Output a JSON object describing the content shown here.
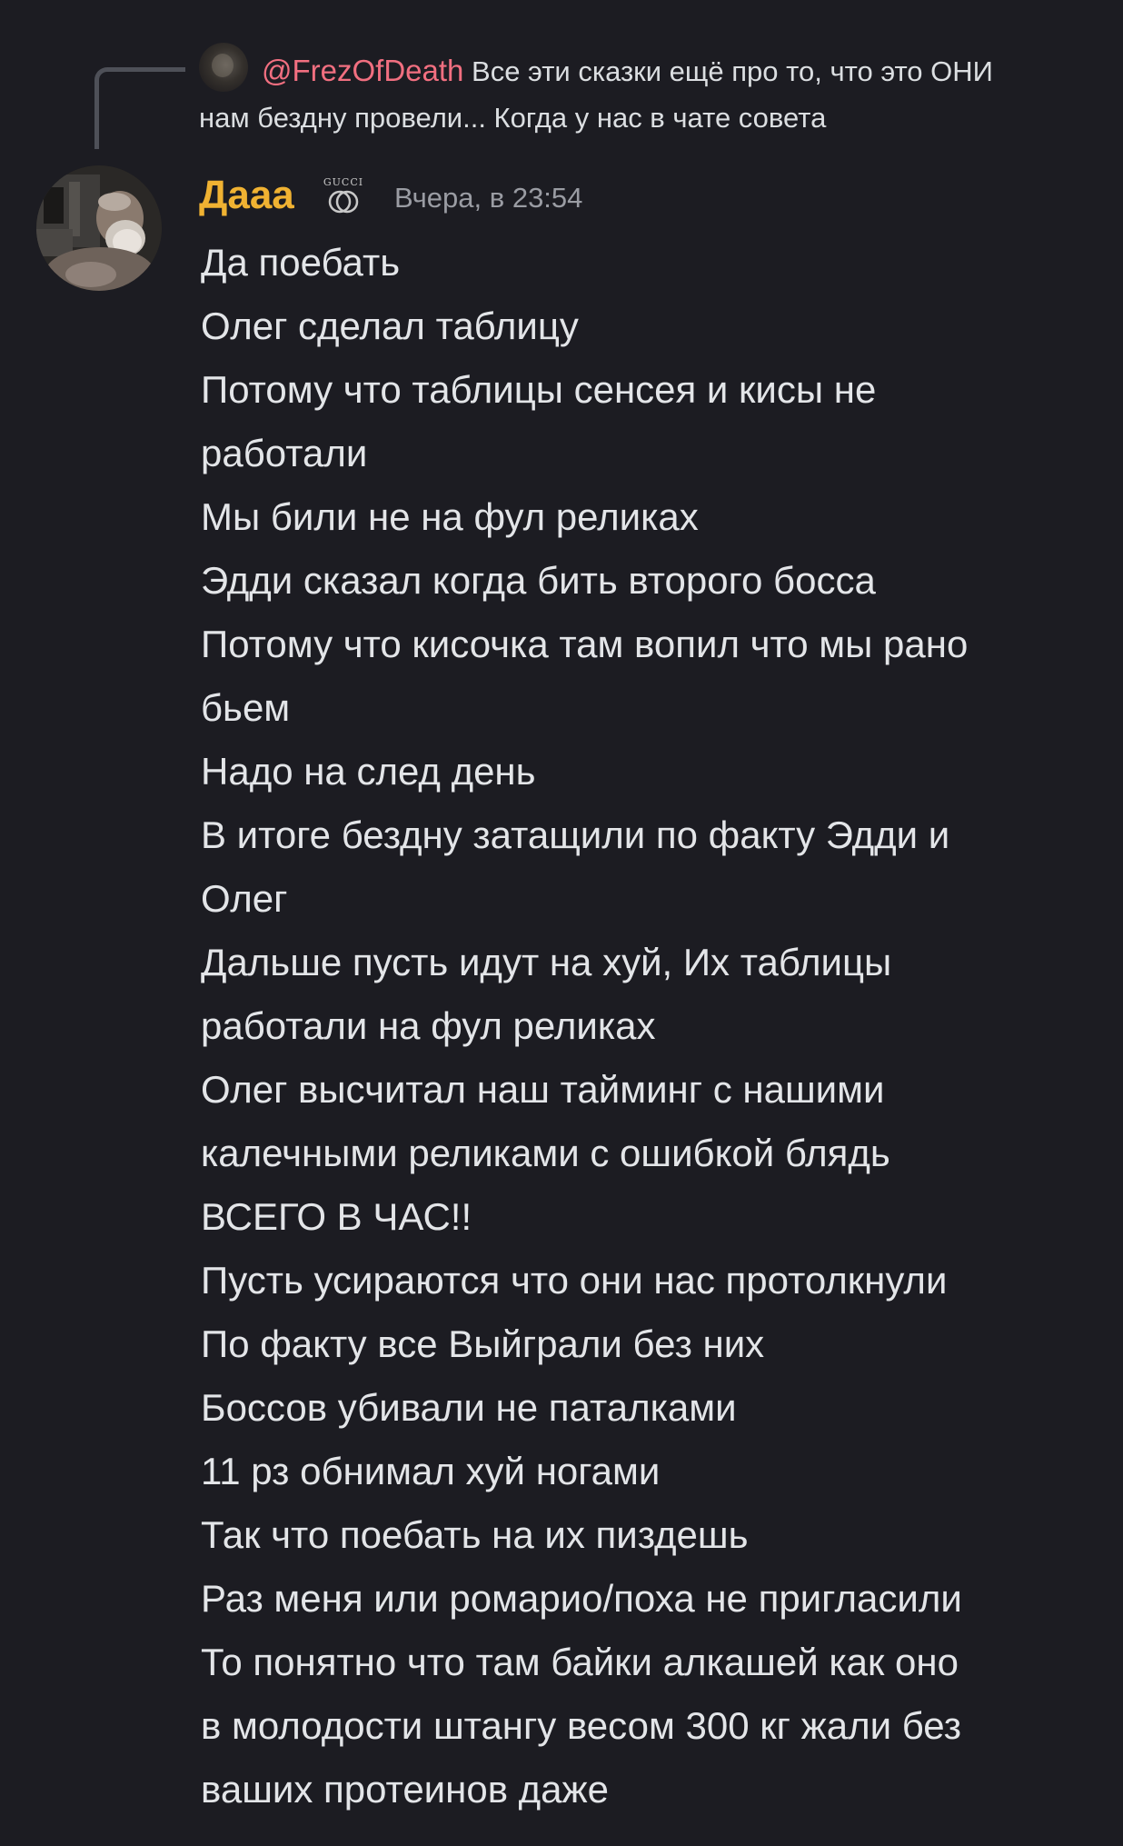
{
  "reply": {
    "mention": "@FrezOfDeath",
    "text": "Все эти сказки ещё про то, что это ОНИ нам бездну провели... Когда у нас в чате совета"
  },
  "message": {
    "author": "Дааа",
    "badge_icon": "gucci-badge-icon",
    "timestamp": "Вчера, в 23:54",
    "author_color": "#f0b232",
    "mention_color": "#f16f80",
    "lines": [
      "Да поебать",
      "Олег сделал таблицу",
      "Потому что таблицы сенсея и кисы не",
      "работали",
      "Мы били не на фул реликах",
      "Эдди сказал когда бить второго босса",
      "Потому что кисочка там вопил что мы рано",
      "бьем",
      "Надо на след день",
      "В итоге бездну затащили по факту Эдди и",
      "Олег",
      "Дальше пусть идут на хуй, Их таблицы",
      "работали на фул реликах",
      "Олег высчитал наш тайминг с нашими",
      "калечными реликами с ошибкой блядь",
      "ВСЕГО В ЧАС!!",
      "Пусть усираются что они нас протолкнули",
      "По факту все Выйграли без них",
      "Боссов убивали не паталками",
      "11 рз обнимал хуй ногами",
      "Так что поебать на их пиздешь",
      "Раз меня или ромарио/поха не пригласили",
      "То понятно что там байки алкашей как оно",
      "в молодости штангу весом 300 кг жали без",
      "ваших протеинов даже"
    ]
  }
}
